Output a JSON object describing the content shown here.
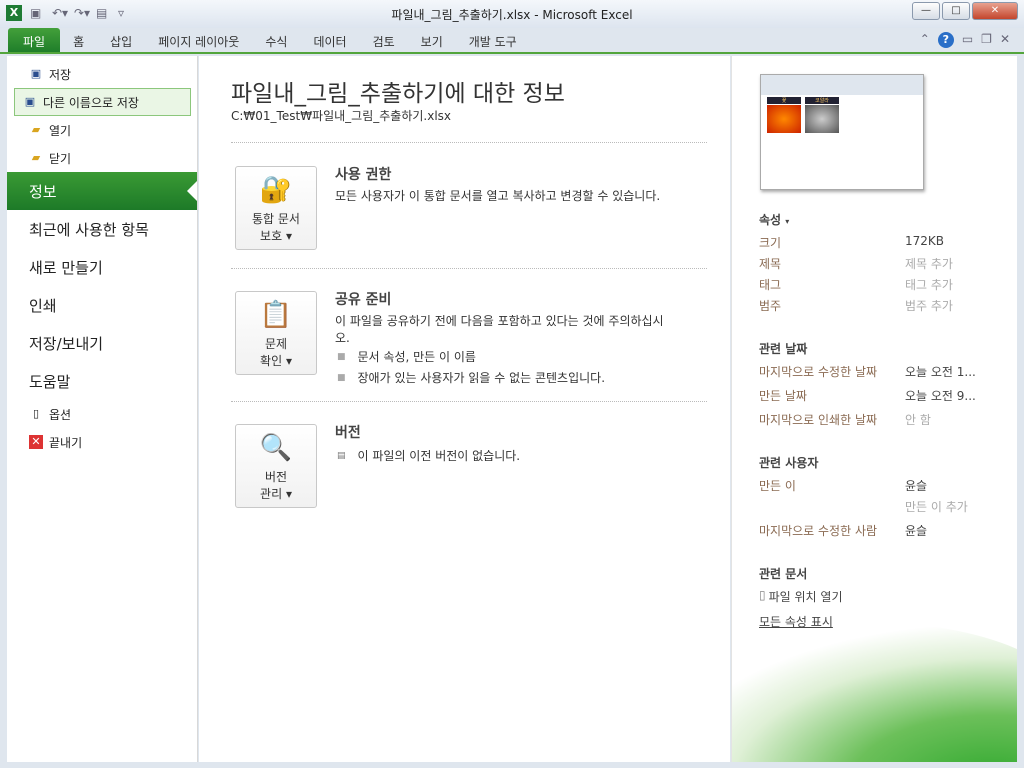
{
  "window": {
    "title": "파일내_그림_추출하기.xlsx  -  Microsoft Excel"
  },
  "ribbon": {
    "tabs": [
      "파일",
      "홈",
      "삽입",
      "페이지 레이아웃",
      "수식",
      "데이터",
      "검토",
      "보기",
      "개발 도구"
    ]
  },
  "sidebar": {
    "items": [
      {
        "label": "저장"
      },
      {
        "label": "다른 이름으로 저장"
      },
      {
        "label": "열기"
      },
      {
        "label": "닫기"
      }
    ],
    "big": [
      "정보",
      "최근에 사용한 항목",
      "새로 만들기",
      "인쇄",
      "저장/보내기",
      "도움말"
    ],
    "bottom": [
      {
        "label": "옵션"
      },
      {
        "label": "끝내기"
      }
    ]
  },
  "main": {
    "title": "파일내_그림_추출하기에 대한 정보",
    "path": "C:₩01_Test₩파일내_그림_추출하기.xlsx",
    "sections": [
      {
        "btn1": "통합 문서",
        "btn2": "보호",
        "heading": "사용 권한",
        "text": "모든 사용자가 이 통합 문서를 열고 복사하고 변경할 수 있습니다."
      },
      {
        "btn1": "문제",
        "btn2": "확인",
        "heading": "공유 준비",
        "text": "이 파일을 공유하기 전에 다음을 포함하고 있다는 것에 주의하십시오.",
        "bullets": [
          "문서 속성, 만든 이 이름",
          "장애가 있는 사용자가 읽을 수 없는 콘텐츠입니다."
        ]
      },
      {
        "btn1": "버전",
        "btn2": "관리",
        "heading": "버전",
        "text": "이 파일의 이전 버전이 없습니다."
      }
    ]
  },
  "props": {
    "heading": "속성",
    "rows": [
      {
        "k": "크기",
        "v": "172KB"
      },
      {
        "k": "제목",
        "v": "제목 추가"
      },
      {
        "k": "태그",
        "v": "태그 추가"
      },
      {
        "k": "범주",
        "v": "범주 추가"
      }
    ],
    "dates_heading": "관련 날짜",
    "dates": [
      {
        "k": "마지막으로 수정한 날짜",
        "v": "오늘 오전 1..."
      },
      {
        "k": "만든 날짜",
        "v": "오늘 오전 9..."
      },
      {
        "k": "마지막으로 인쇄한 날짜",
        "v": "안 함"
      }
    ],
    "people_heading": "관련 사용자",
    "people": [
      {
        "k": "만든 이",
        "v": "윤슬"
      },
      {
        "k": "",
        "v": "만든 이 추가"
      },
      {
        "k": "마지막으로 수정한 사람",
        "v": "윤슬"
      }
    ],
    "docs_heading": "관련 문서",
    "open_location": "파일 위치 열기",
    "show_all": "모든 속성 표시"
  },
  "thumb": {
    "h1": "꽃",
    "h2": "코알라"
  }
}
